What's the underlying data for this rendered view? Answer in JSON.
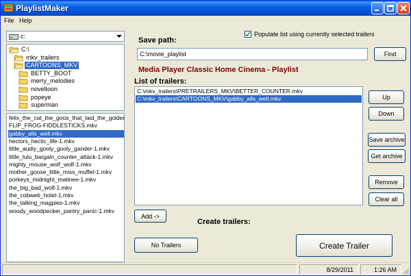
{
  "window": {
    "title": "PlaylistMaker"
  },
  "menu": {
    "items": [
      "File",
      "Help"
    ]
  },
  "drive": {
    "selected": "c:"
  },
  "folder_tree": [
    {
      "label": "C:\\",
      "indent": 0,
      "open": true,
      "selected": false
    },
    {
      "label": "mkv_trailers",
      "indent": 1,
      "open": true,
      "selected": false
    },
    {
      "label": "CARTOONS_MKV",
      "indent": 1,
      "open": true,
      "selected": true
    },
    {
      "label": "BETTY_BOOT",
      "indent": 2,
      "open": false,
      "selected": false
    },
    {
      "label": "merry_melodies",
      "indent": 2,
      "open": false,
      "selected": false
    },
    {
      "label": "noveltoon",
      "indent": 2,
      "open": false,
      "selected": false
    },
    {
      "label": "popeye",
      "indent": 2,
      "open": false,
      "selected": false
    },
    {
      "label": "superman",
      "indent": 2,
      "open": false,
      "selected": false
    }
  ],
  "file_list": [
    {
      "name": "felix_the_cat_the_goos_that_laid_the_golden_",
      "selected": false
    },
    {
      "name": "FLIP_FROG-FIDDLESTICKS.mkv",
      "selected": false
    },
    {
      "name": "gabby_alls_well.mkv",
      "selected": true
    },
    {
      "name": "hectors_hectic_life-1.mkv",
      "selected": false
    },
    {
      "name": "little_audiy_gooly_gooly_gander-1.mkv",
      "selected": false
    },
    {
      "name": "little_lulu_bargain_counter_attack-1.mkv",
      "selected": false
    },
    {
      "name": "mighty_mouse_wolf_wolf-1.mkv",
      "selected": false
    },
    {
      "name": "mother_goose_little_miss_muffet-1.mkv",
      "selected": false
    },
    {
      "name": "porkeys_midnight_matinee-1.mkv",
      "selected": false
    },
    {
      "name": "the_big_bad_wolf-1.mkv",
      "selected": false
    },
    {
      "name": "the_cobweb_hotel-1.mkv",
      "selected": false
    },
    {
      "name": "the_talking_magpies-1.mkv",
      "selected": false
    },
    {
      "name": "woody_woodpecker_pantry_panic-1.mkv",
      "selected": false
    }
  ],
  "save_path": {
    "label": "Save path:",
    "value": "C:\\movie_playlist",
    "find_label": "Find"
  },
  "populate": {
    "checked": true,
    "label": "Populate list using currently selected trailers"
  },
  "player_heading": "Media Player Classic Home Cinema - Playlist",
  "trailers": {
    "label": "List of trailers:",
    "items": [
      {
        "path": "C:\\mkv_trailers\\PRETRAILERS_MKV\\BETTER_COUNTER.mkv",
        "selected": false
      },
      {
        "path": "C:\\mkv_trailers\\CARTOONS_MKV\\gabby_alls_well.mkv",
        "selected": true
      }
    ]
  },
  "buttons": {
    "up": "Up",
    "down": "Down",
    "save_archive": "Save archive",
    "get_archive": "Get archive",
    "remove": "Remove",
    "clear_all": "Clear all",
    "add": "Add ->",
    "no_trailers": "No Trailers",
    "create_trailer": "Create Trailer"
  },
  "create_trailers_label": "Create trailers:",
  "status": {
    "date": "8/29/2011",
    "time": "1:26 AM"
  },
  "colors": {
    "titlebar": "#0450d2",
    "selection": "#316ac5",
    "heading": "#800000",
    "face": "#ece9d8"
  }
}
